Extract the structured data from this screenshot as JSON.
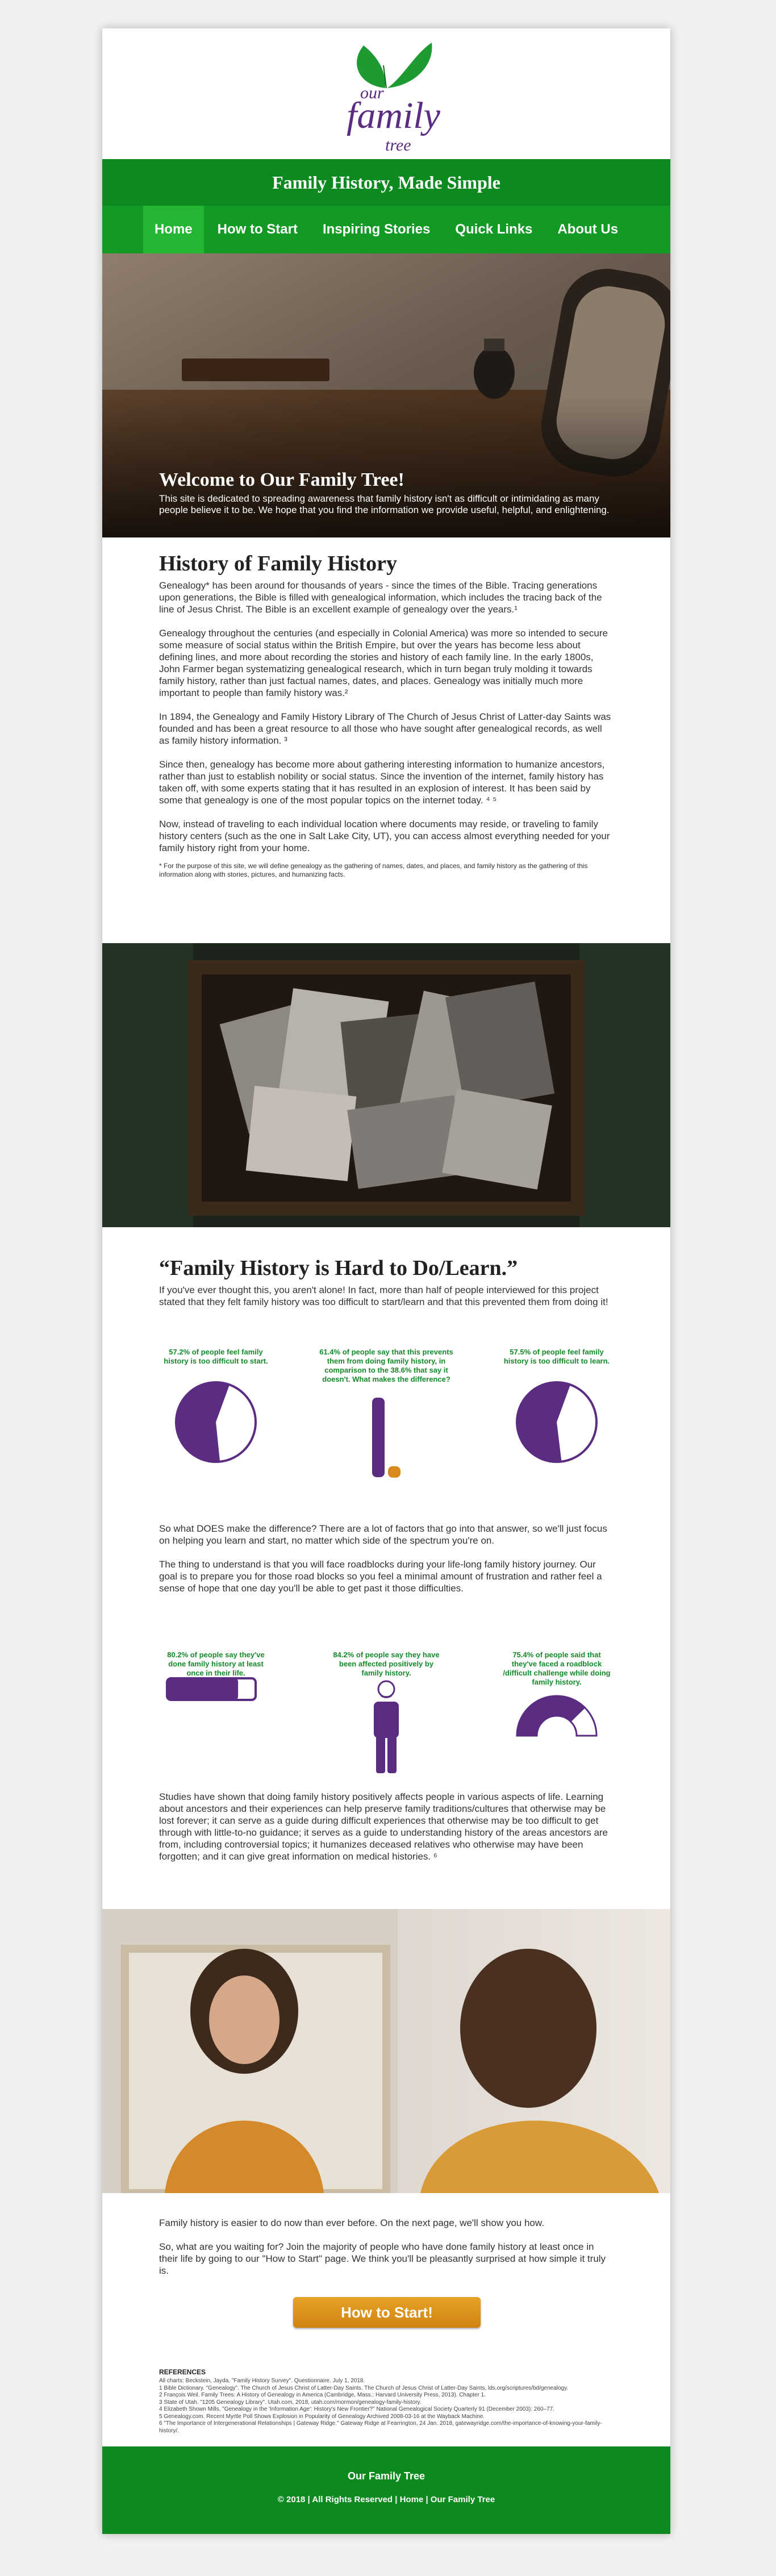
{
  "logo": {
    "line1": "our",
    "line2": "family",
    "line3": "tree"
  },
  "tagline": "Family History, Made Simple",
  "nav": [
    "Home",
    "How to Start",
    "Inspiring Stories",
    "Quick Links",
    "About Us"
  ],
  "hero": {
    "title": "Welcome to Our Family Tree!",
    "text": "This site is dedicated to spreading awareness that family history isn't as difficult or intimidating as many people believe it to be. We hope that you find the information we provide useful, helpful, and enlightening."
  },
  "history": {
    "heading": "History of Family History",
    "p1": "Genealogy* has been around for thousands of years - since the times of the Bible. Tracing generations upon generations, the Bible is filled with genealogical information, which includes the tracing back of the line of Jesus Christ. The Bible is an excellent example of genealogy over the years.¹",
    "p2": "Genealogy throughout the centuries (and especially in Colonial America) was more so intended to secure some measure of social status within the British Empire, but over the years has become less about defining lines, and more about recording the stories and history of each family line. In the early 1800s, John Farmer began systematizing genealogical research, which in turn began truly molding it towards family history, rather than just factual names, dates, and places. Genealogy was initially much more important to people than family history was.²",
    "p3": "In 1894, the Genealogy and Family History Library of The Church of Jesus Christ of Latter-day Saints was founded and has been a great resource to all those who have sought after genealogical records, as well as family history information. ³",
    "p4": "Since then, genealogy has become more about gathering interesting information to humanize ancestors, rather than just to establish nobility or social status. Since the invention of the internet, family history has taken off, with some experts stating that it has resulted in an explosion of interest. It has been said by some that genealogy is one of the most popular topics on the internet today. ⁴ ⁵",
    "p5": "Now, instead of traveling to each individual location where documents may reside, or traveling to family history centers (such as the one in Salt Lake City, UT), you can access almost everything needed for your family history right from your home.",
    "footnote": "* For the purpose of this site, we will define genealogy as the gathering of names, dates, and places, and family history as the gathering of this information along with stories, pictures, and humanizing facts."
  },
  "hard": {
    "heading": "“Family History is Hard to Do/Learn.”",
    "p1": "If you've ever thought this, you aren't alone! In fact, more than half of people interviewed for this project stated that they felt family history was too difficult to start/learn and that this prevented them from doing it!",
    "stats": [
      {
        "caption": "57.2% of people feel family history is too difficult to start.",
        "value": 57.2
      },
      {
        "caption": "61.4% of people say that this prevents them from doing family history, in comparison to the 38.6% that say it doesn't. What makes the difference?",
        "values": [
          61.4,
          38.6
        ]
      },
      {
        "caption": "57.5% of people feel family history is too difficult to learn.",
        "value": 57.5
      }
    ],
    "p2": "So what DOES make the difference? There are a lot of factors that go into that answer, so we'll just focus on helping you learn and start, no matter which side of the spectrum you're on.",
    "p3": "The thing to understand is that you will face roadblocks during your life-long family history journey. Our goal is to prepare you for those road blocks so you feel a minimal amount of frustration and rather feel a sense of hope that one day you'll be able to get past it those difficulties.",
    "stats2": [
      {
        "caption": "80.2% of people say they've done family history at least once in their life.",
        "value": 80.2
      },
      {
        "caption": "84.2% of people say they have been affected positively by family history.",
        "value": 84.2
      },
      {
        "caption": "75.4% of people said that they've faced a roadblock /difficult challenge while doing family history.",
        "value": 75.4
      }
    ],
    "p4": "Studies have shown that doing family history positively affects people in various aspects of life. Learning about ancestors and their experiences can help preserve family traditions/cultures that otherwise may be lost forever; it can serve as a guide during difficult experiences that otherwise may be too difficult to get through with little-to-no guidance; it serves as a guide to understanding history of the areas ancestors are from, including controversial topics; it humanizes deceased relatives who otherwise may have been forgotten; and it can give great information on medical histories. ⁶"
  },
  "closing": {
    "p1": "Family history is easier to do now than ever before. On the next page, we'll show you how.",
    "p2": "So, what are you waiting for? Join the majority of people who have done family history at least once in their life by going to our \"How to Start\" page. We think you'll be pleasantly surprised at how simple it truly is.",
    "cta": "How to Start!"
  },
  "references": {
    "heading": "REFERENCES",
    "lines": [
      "All charts: Beckstein, Jayda. \"Family History Survey\". Questionnaire. July 1, 2018.",
      "1 Bible Dictionary. \"Genealogy\". The Church of Jesus Christ of Latter-Day Saints. The Church of Jesus Christ of Latter-Day Saints, lds.org/scriptures/bd/genealogy.",
      "2 François Weil. Family Trees: A History of Genealogy in America (Cambridge, Mass.: Harvard University Press, 2013). Chapter 1.",
      "3 State of Utah. \"1205 Genealogy Library\". Utah.com, 2018, utah.com/mormon/genealogy-family-history.",
      "4 Elizabeth Shown Mills, \"Genealogy in the 'Information Age': History's New Frontier?\" National Genealogical Society Quarterly 91 (December 2003): 260–77.",
      "5 Genealogy.com. Recent Myrtle Poll Shows Explosion in Popularity of Genealogy Archived 2008-03-16 at the Wayback Machine.",
      "6 \"The Importance of Intergenerational Relationships | Gateway Ridge.\" Gateway Ridge at Fearrington, 24 Jan. 2018, gatewayridge.com/the-importance-of-knowing-your-family-history/."
    ]
  },
  "footer": {
    "title": "Our Family Tree",
    "links": "© 2018  |  All Rights Reserved  |  Home  |  Our Family Tree"
  },
  "colors": {
    "green": "#0c8a1f",
    "purple": "#5a2d82",
    "orange": "#d88a1a"
  }
}
